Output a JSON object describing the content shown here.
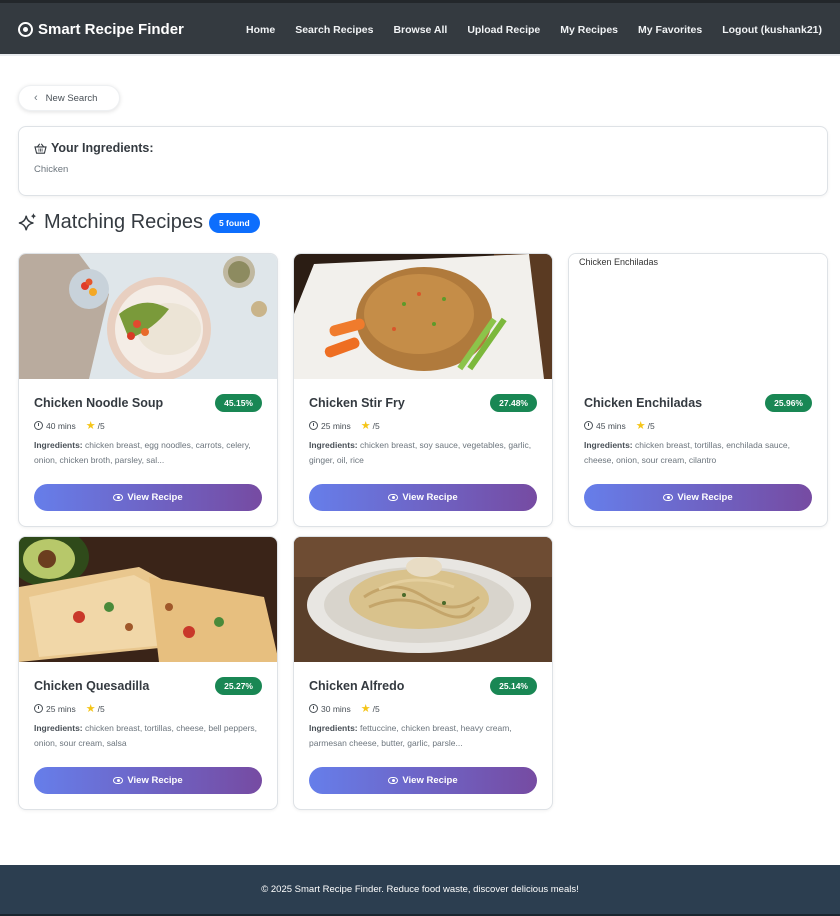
{
  "nav": {
    "brand": "Smart Recipe Finder",
    "links": [
      "Home",
      "Search Recipes",
      "Browse All",
      "Upload Recipe",
      "My Recipes",
      "My Favorites",
      "Logout (kushank21)"
    ]
  },
  "back_button": "New Search",
  "ingredients": {
    "title": "Your Ingredients:",
    "items": "Chicken"
  },
  "results": {
    "heading": "Matching Recipes",
    "count_badge": "5 found"
  },
  "recipes": [
    {
      "name": "Chicken Noodle Soup",
      "match": "45.15%",
      "time": "40 mins",
      "rating": "/5",
      "ingredients_label": "Ingredients:",
      "ingredients": "chicken breast, egg noodles, carrots, celery, onion, chicken broth, parsley, sal...",
      "button": "View Recipe",
      "image": "bowl-image"
    },
    {
      "name": "Chicken Stir Fry",
      "match": "27.48%",
      "time": "25 mins",
      "rating": "/5",
      "ingredients_label": "Ingredients:",
      "ingredients": "chicken breast, soy sauce, vegetables, garlic, ginger, oil, rice",
      "button": "View Recipe",
      "image": "rice-image"
    },
    {
      "name": "Chicken Enchiladas",
      "match": "25.96%",
      "time": "45 mins",
      "rating": "/5",
      "ingredients_label": "Ingredients:",
      "ingredients": "chicken breast, tortillas, enchilada sauce, cheese, onion, sour cream, cilantro",
      "button": "View Recipe",
      "image_alt": "Chicken Enchiladas"
    },
    {
      "name": "Chicken Quesadilla",
      "match": "25.27%",
      "time": "25 mins",
      "rating": "/5",
      "ingredients_label": "Ingredients:",
      "ingredients": "chicken breast, tortillas, cheese, bell peppers, onion, sour cream, salsa",
      "button": "View Recipe",
      "image": "quesadilla-image"
    },
    {
      "name": "Chicken Alfredo",
      "match": "25.14%",
      "time": "30 mins",
      "rating": "/5",
      "ingredients_label": "Ingredients:",
      "ingredients": "fettuccine, chicken breast, heavy cream, parmesan cheese, butter, garlic, parsle...",
      "button": "View Recipe",
      "image": "pasta-image"
    }
  ],
  "footer": "© 2025 Smart Recipe Finder. Reduce food waste, discover delicious meals!"
}
